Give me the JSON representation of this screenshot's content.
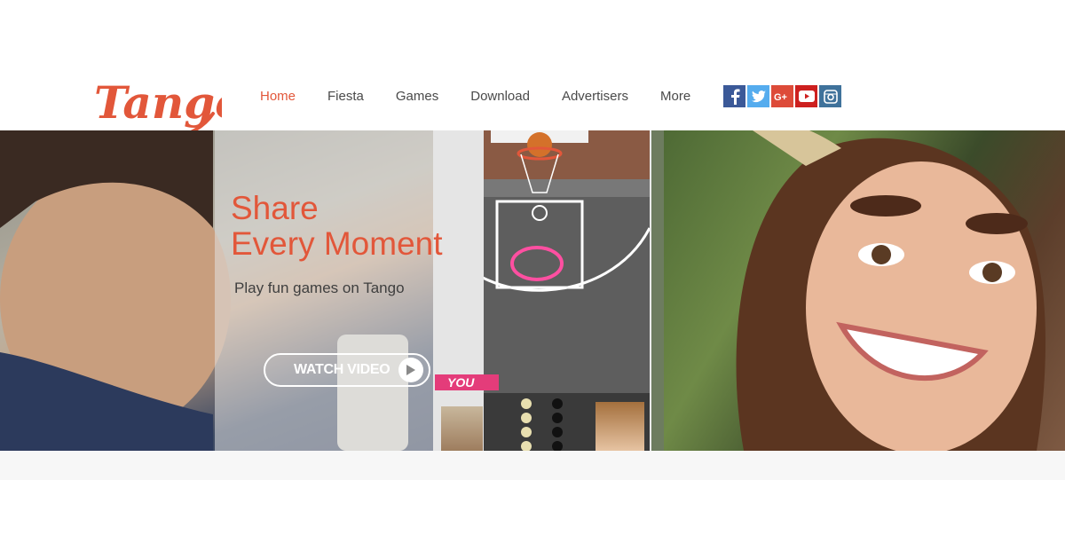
{
  "brand": {
    "logo_text": "Tango",
    "color": "#e2573a"
  },
  "nav": {
    "items": [
      {
        "label": "Home",
        "active": true
      },
      {
        "label": "Fiesta",
        "active": false
      },
      {
        "label": "Games",
        "active": false
      },
      {
        "label": "Download",
        "active": false
      },
      {
        "label": "Advertisers",
        "active": false
      },
      {
        "label": "More",
        "active": false
      }
    ]
  },
  "social": [
    {
      "name": "facebook-icon",
      "color": "#3b5998"
    },
    {
      "name": "twitter-icon",
      "color": "#55acee"
    },
    {
      "name": "google-plus-icon",
      "color": "#dd4b39"
    },
    {
      "name": "youtube-icon",
      "color": "#cd201f"
    },
    {
      "name": "instagram-icon",
      "color": "#3f729b"
    }
  ],
  "hero": {
    "title_line1": "Share",
    "title_line2": "Every Moment",
    "subtitle": "Play fun games on Tango",
    "cta_label": "WATCH VIDEO",
    "you_tag": "YOU"
  }
}
